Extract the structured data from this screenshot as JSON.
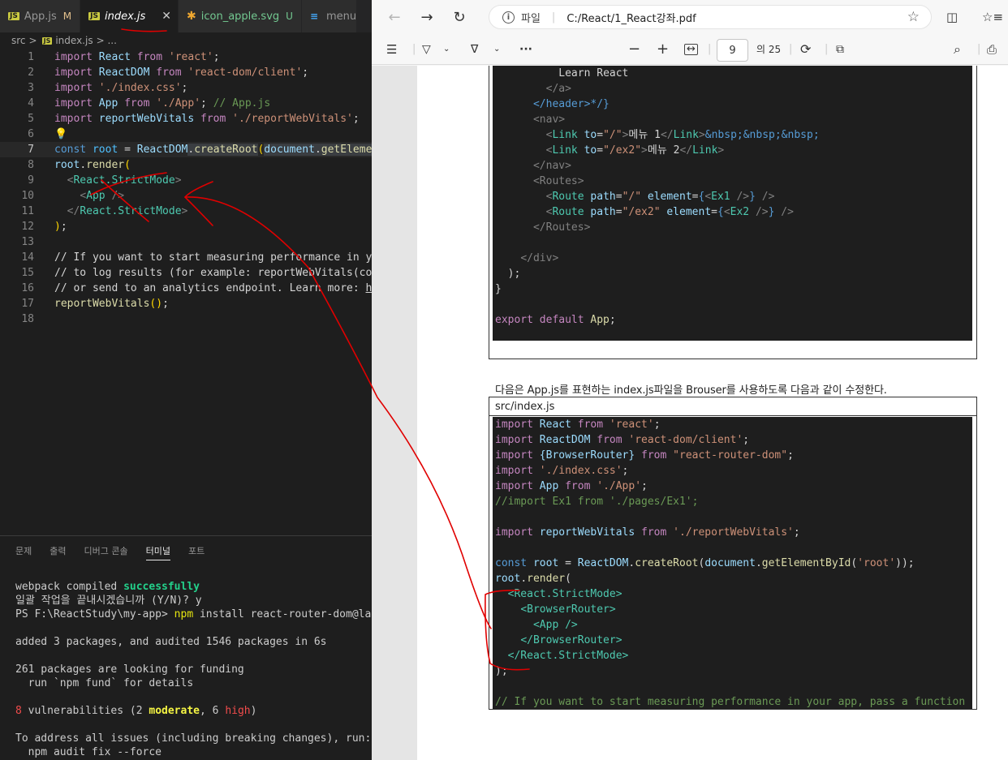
{
  "vscode": {
    "tabs": [
      {
        "label": "App.js",
        "status": "M"
      },
      {
        "label": "index.js"
      },
      {
        "label": "icon_apple.svg",
        "status": "U"
      },
      {
        "label": "menu"
      }
    ],
    "breadcrumb": {
      "folder": "src",
      "sep": ">",
      "file": "index.js",
      "more": "> ..."
    },
    "line_numbers": [
      "1",
      "2",
      "3",
      "4",
      "5",
      "6",
      "7",
      "8",
      "9",
      "10",
      "11",
      "12",
      "13",
      "14",
      "15",
      "16",
      "17",
      "18"
    ],
    "code": {
      "l1": [
        "import",
        "React",
        "from",
        "'react'"
      ],
      "l2": [
        "import",
        "ReactDOM",
        "from",
        "'react-dom/client'"
      ],
      "l3": [
        "import",
        "'./index.css'"
      ],
      "l4": [
        "import",
        "App",
        "from",
        "'./App'",
        "// App.js"
      ],
      "l5": [
        "import",
        "reportWebVitals",
        "from",
        "'./reportWebVitals'"
      ],
      "l7": [
        "const",
        "root",
        "ReactDOM",
        "createRoot",
        "document",
        "getElemen"
      ],
      "l8": [
        "root",
        "render"
      ],
      "l9": [
        "React.StrictMode"
      ],
      "l10": [
        "App"
      ],
      "l11": [
        "React.StrictMode"
      ],
      "l14": "// If you want to start measuring performance in yo",
      "l15": "// to log results (for example: reportWebVitals(con",
      "l16a": "// or send to an analytics endpoint. Learn more: ",
      "l16b": "ht",
      "l17": "reportWebVitals"
    },
    "panel_tabs": [
      "문제",
      "출력",
      "디버그 콘솔",
      "터미널",
      "포트"
    ],
    "terminal": {
      "t1a": "webpack compiled ",
      "t1b": "successfully",
      "t2": "일괄 작업을 끝내시겠습니까 (Y/N)? y",
      "t3a": "PS F:\\ReactStudy\\my-app> ",
      "t3b": "npm",
      "t3c": " install react-router-dom@lat",
      "t4": "added 3 packages, and audited 1546 packages in 6s",
      "t5": "261 packages are looking for funding",
      "t6": "  run `npm fund` for details",
      "t7a": "8",
      "t7b": " vulnerabilities (2 ",
      "t7c": "moderate",
      "t7d": ", 6 ",
      "t7e": "high",
      "t7f": ")",
      "t8": "To address all issues (including breaking changes), run:",
      "t9": "  npm audit fix --force"
    }
  },
  "edge": {
    "address_label": "파일",
    "address_url": "C:/React/1_React강좌.pdf",
    "page_current": "9",
    "page_total": "의 25"
  },
  "pdf": {
    "top_code": {
      "c1": "Learn React",
      "c2": "</a>",
      "c3": "</header>*/}",
      "c4": "<nav>",
      "c5a": "to",
      "c5b": "\"/\"",
      "c5c": "메뉴 1",
      "c5d": "&nbsp;&nbsp;&nbsp;",
      "c6a": "to",
      "c6b": "\"/ex2\"",
      "c6c": "메뉴 2",
      "c7": "</nav>",
      "c8": "<Routes>",
      "c9a": "path",
      "c9b": "\"/\"",
      "c9c": "element",
      "c9d": "Ex1",
      "c10a": "path",
      "c10b": "\"/ex2\"",
      "c10c": "element",
      "c10d": "Ex2",
      "c11": "</Routes>",
      "c12": "</div>",
      "c13": ");",
      "c14": "}",
      "c15a": "export default",
      "c15b": "App"
    },
    "paragraph": "다음은 App.js를 표현하는 index.js파일을 Brouser를 사용하도록 다음과 같이 수정한다.",
    "file_label": "src/index.js",
    "bottom_code": {
      "b1": [
        "import",
        "React",
        "from",
        "'react'"
      ],
      "b2": [
        "import",
        "ReactDOM",
        "from",
        "'react-dom/client'"
      ],
      "b3": [
        "import",
        "{BrowserRouter}",
        "from",
        "\"react-router-dom\""
      ],
      "b4": [
        "import",
        "'./index.css'"
      ],
      "b5": [
        "import",
        "App",
        "from",
        "'./App'"
      ],
      "b6": "//import Ex1 from './pages/Ex1';",
      "b7": [
        "import",
        "reportWebVitals",
        "from",
        "'./reportWebVitals'"
      ],
      "b8": [
        "const",
        "root",
        "ReactDOM",
        "createRoot",
        "document",
        "getElementById",
        "'root'"
      ],
      "b9": [
        "root",
        "render"
      ],
      "b10": "<React.StrictMode>",
      "b11": "<BrowserRouter>",
      "b12": "<App />",
      "b13": "</BrowserRouter>",
      "b14": "</React.StrictMode>",
      "b15": ");",
      "b16": "// If you want to start measuring performance in your app, pass a function"
    }
  }
}
